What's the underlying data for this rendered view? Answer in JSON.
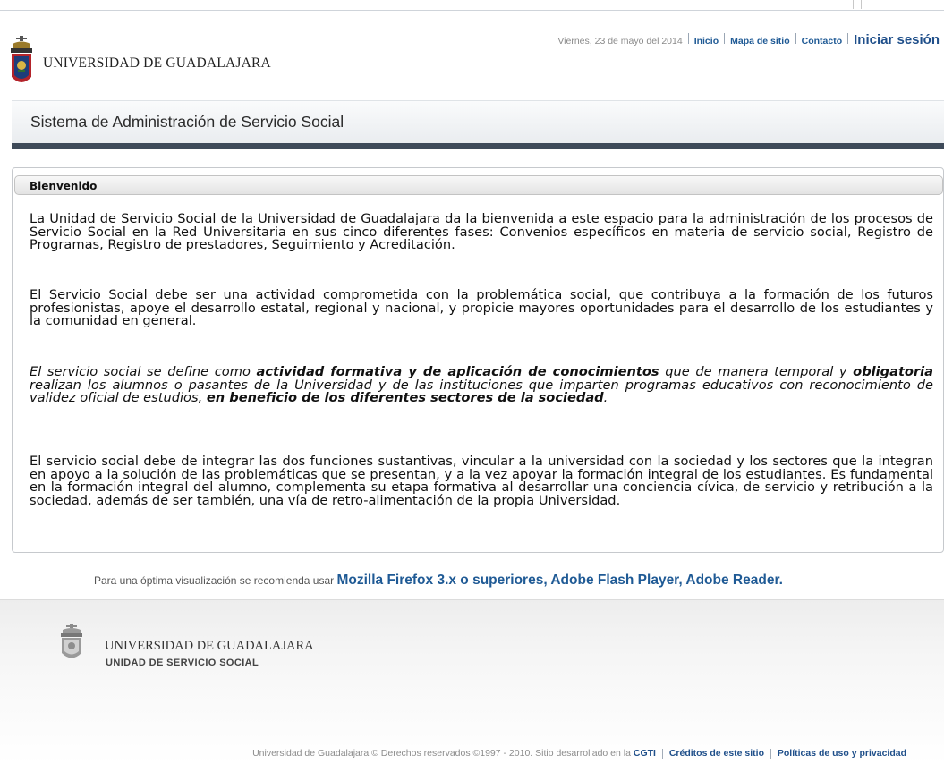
{
  "header": {
    "brand": "UNIVERSIDAD DE GUADALAJARA",
    "date": "Viernes, 23 de mayo del 2014",
    "nav": [
      {
        "label": "Inicio"
      },
      {
        "label": "Mapa de sitio"
      },
      {
        "label": "Contacto"
      }
    ],
    "login_label": "Iniciar sesión"
  },
  "system_title": "Sistema de Administración de Servicio Social",
  "welcome": {
    "heading": "Bienvenido",
    "p1": "La Unidad de Servicio Social de la Universidad de Guadalajara da la bienvenida a este espacio para la administración de los procesos de Servicio Social en la Red Universitaria en sus cinco diferentes fases: Convenios específicos en materia de servicio social, Registro de Programas, Registro de prestadores, Seguimiento y Acreditación.",
    "p2": "El Servicio Social debe ser una actividad comprometida con la problemática social, que contribuya a la formación de los futuros profesionistas, apoye el desarrollo estatal, regional y nacional, y propicie mayores oportunidades para el desarrollo de los estudiantes y la comunidad en general.",
    "p3": {
      "a": "El servicio social se define como ",
      "b": "actividad formativa y de aplicación de conocimientos",
      "c": " que de manera temporal y ",
      "d": "obligatoria",
      "e": " realizan los alumnos o pasantes de la Universidad y de las instituciones que imparten programas educativos con reconocimiento de validez oficial de estudios, ",
      "f": "en beneficio de los diferentes sectores de la sociedad",
      "g": "."
    },
    "p4": "El servicio social debe de integrar las dos funciones sustantivas, vincular a la universidad con la sociedad y los sectores que la integran en apoyo a la solución de las problemáticas que se presentan, y a la vez apoyar la formación integral de los estudiantes. Es fundamental en la formación integral del alumno, complementa su etapa formativa al desarrollar una conciencia cívica, de servicio y retribución a la sociedad, además de ser también, una vía de retro-alimentación de la propia Universidad."
  },
  "recommendation": {
    "prefix": "Para una óptima visualización se recomienda usar ",
    "links": "Mozilla Firefox 3.x o superiores, Adobe Flash Player, Adobe Reader."
  },
  "footer": {
    "brand": "UNIVERSIDAD DE GUADALAJARA",
    "sub": "UNIDAD DE SERVICIO SOCIAL",
    "copyright": "Universidad de Guadalajara © Derechos reservados ©1997 - 2010. Sitio desarrollado en la ",
    "cgti": "CGTI",
    "credits": "Créditos de este sitio",
    "policies": "Políticas de uso y privacidad"
  },
  "colors": {
    "link_blue": "#1f5a95",
    "band_dark": "#3e4a59"
  },
  "icons": [
    "university-shield-icon",
    "footer-shield-icon"
  ]
}
